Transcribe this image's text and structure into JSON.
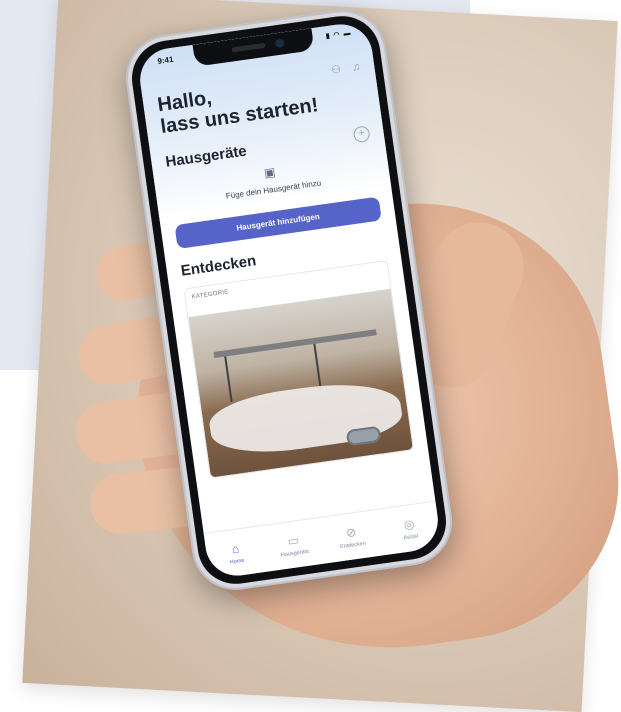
{
  "status_bar": {
    "time": "9:41",
    "icons": "▮ ◠ ▬"
  },
  "header": {
    "user_icon": "user-icon",
    "bell_icon": "bell-icon"
  },
  "greeting": {
    "line1": "Hallo,",
    "line2": "lass uns starten!"
  },
  "appliances": {
    "title": "Hausgeräte",
    "add_icon": "plus-circle-icon",
    "empty_icon": "appliance-add-icon",
    "empty_text": "Füge dein Hausgerät hinzu",
    "add_button": "Hausgerät hinzufügen"
  },
  "discover": {
    "title": "Entdecken",
    "card_label": "KATEGORIE"
  },
  "tabs": [
    {
      "label": "Home",
      "icon": "home-icon",
      "active": true
    },
    {
      "label": "Hausgeräte",
      "icon": "appliance-icon",
      "active": false
    },
    {
      "label": "Entdecken",
      "icon": "compass-icon",
      "active": false
    },
    {
      "label": "Assist",
      "icon": "assist-icon",
      "active": false
    }
  ],
  "colors": {
    "accent": "#5664c9",
    "text_dark": "#1d2330",
    "muted": "#9aa6b8"
  }
}
